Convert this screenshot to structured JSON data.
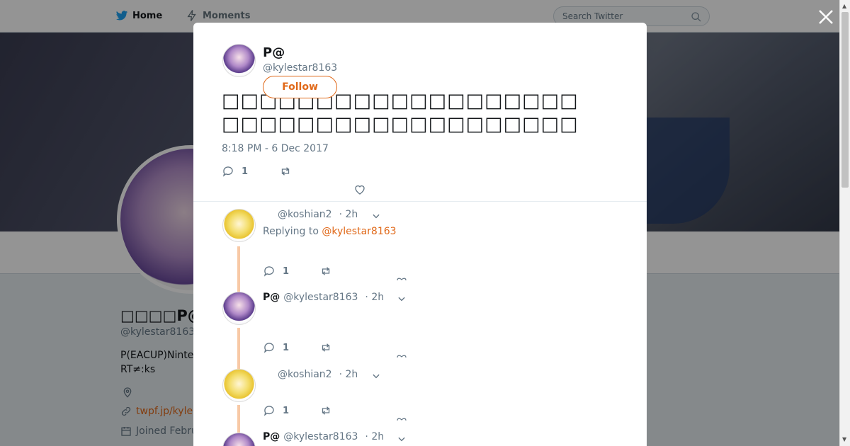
{
  "nav": {
    "home_label": "Home",
    "moments_label": "Moments",
    "search_placeholder": "Search Twitter"
  },
  "profile": {
    "name": "□□□□P@□□",
    "handle": "@kylestar8163",
    "bio_line1": "P(EACUP)Ninte",
    "bio_line2": "RT≠:ks",
    "link": "twpf.jp/kyle",
    "joined": "Joined Febru"
  },
  "tweet": {
    "name": "P@",
    "handle": "@kylestar8163",
    "follow_label": "Follow",
    "text_line1": "□□□□□□□□□□□□□□□□□□□",
    "text_line2": "□□□□□□□□□□□□□□□□□□□",
    "date": "8:18 PM - 6 Dec 2017",
    "reply_count": "1"
  },
  "replies": [
    {
      "name": "",
      "handle": "@koshian2",
      "time": "· 2h",
      "replying_prefix": "Replying to",
      "replying_to": "@kylestar8163",
      "reply_count": "1"
    },
    {
      "name": "P@",
      "handle": "@kylestar8163",
      "time": "· 2h",
      "reply_count": "1"
    },
    {
      "name": "",
      "handle": "@koshian2",
      "time": "· 2h",
      "reply_count": "1"
    },
    {
      "name": "P@",
      "handle": "@kylestar8163",
      "time": "· 2h"
    }
  ],
  "colors": {
    "accent": "#e0691a",
    "thread": "#f8c9a6",
    "muted": "#657786",
    "brand": "#1da1f2"
  },
  "icons": {
    "home": "twitter-bird-icon",
    "moments": "lightning-icon",
    "search": "search-icon",
    "close": "close-icon",
    "reply": "reply-icon",
    "retweet": "retweet-icon",
    "like": "heart-icon",
    "caret": "chevron-down-icon"
  }
}
